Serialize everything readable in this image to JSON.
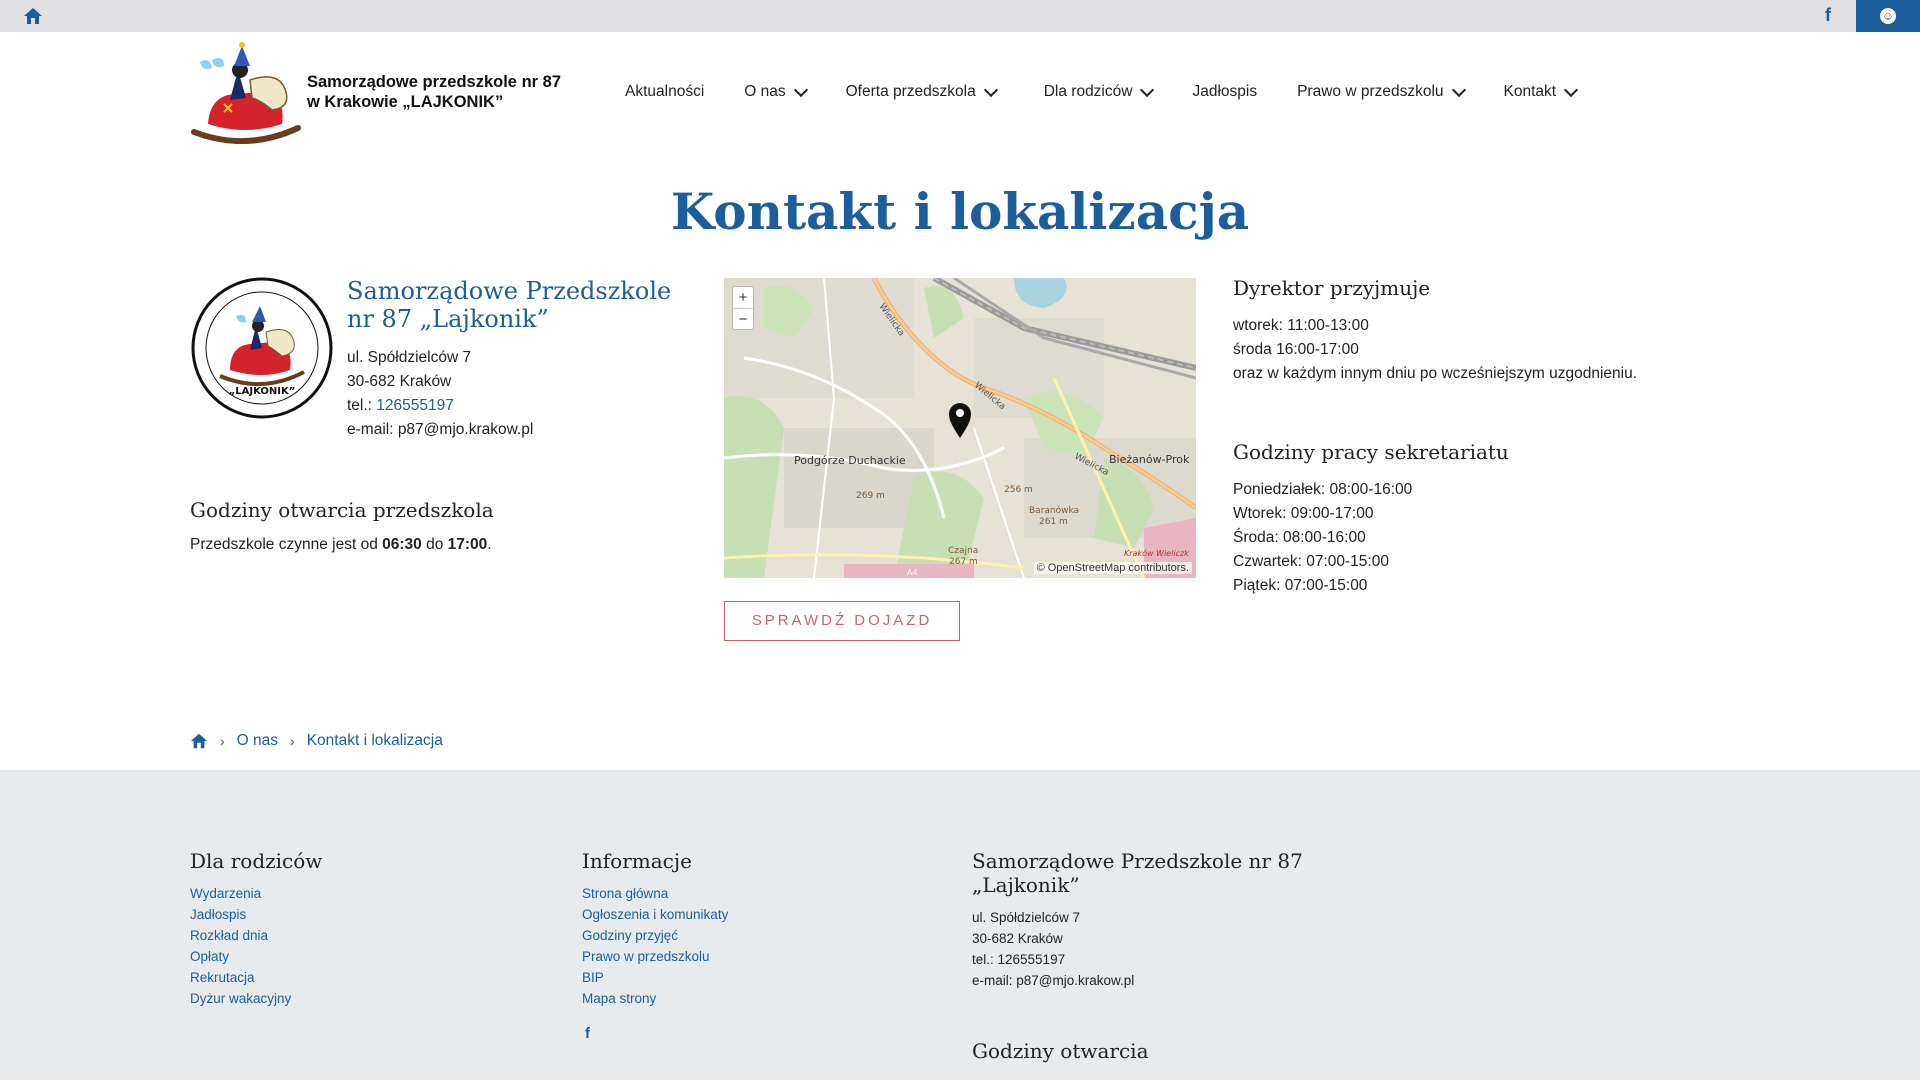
{
  "topbar": {
    "home_icon": "home-icon",
    "facebook_icon": "facebook-icon",
    "accessibility_icon": "accessibility-icon",
    "facebook_glyph": "f"
  },
  "header": {
    "school_name_line1": "Samorządowe przedszkole nr 87",
    "school_name_line2": "w Krakowie „LAJKONIK”"
  },
  "nav": {
    "items": [
      {
        "label": "Aktualności",
        "dropdown": false
      },
      {
        "label": "O nas",
        "dropdown": true
      },
      {
        "label": "Oferta przedszkola",
        "dropdown": true
      },
      {
        "label": "Dla rodziców",
        "dropdown": true
      },
      {
        "label": "Jadłospis",
        "dropdown": false
      },
      {
        "label": "Prawo w przedszkolu",
        "dropdown": true
      },
      {
        "label": "Kontakt",
        "dropdown": true
      }
    ]
  },
  "page": {
    "title": "Kontakt i lokalizacja"
  },
  "contact": {
    "name_line1": "Samorządowe Przedszkole",
    "name_line2": "nr 87 „Lajkonik”",
    "street": "ul. Spółdzielców 7",
    "city": "30-682 Kraków",
    "tel_label": "tel.: ",
    "tel": "126555197",
    "email": "e-mail: p87@mjo.krakow.pl"
  },
  "opening": {
    "heading": "Godziny otwarcia przedszkola",
    "text_prefix": "Przedszkole czynne jest od ",
    "from": "06:30",
    "middle": " do ",
    "to": "17:00",
    "suffix": "."
  },
  "map": {
    "zoom_in": "+",
    "zoom_out": "−",
    "attribution": "© OpenStreetMap contributors.",
    "labels": {
      "podgorze": "Podgórze Duchackie",
      "biezanow": "Bieżanów-Prok",
      "baranowka": "Baranówka",
      "height_261": "261 m",
      "height_256": "256 m",
      "height_269": "269 m",
      "czajna": "Czajna",
      "height_267": "267 m",
      "wielicka": "Wielicka",
      "a4": "A4",
      "krakow_wieliczka": "Kraków Wieliczk"
    },
    "marker_icon": "map-pin-icon"
  },
  "route_button": "SPRAWDŹ DOJAZD",
  "director": {
    "heading": "Dyrektor przyjmuje",
    "lines": [
      "wtorek: 11:00-13:00",
      "środa 16:00-17:00",
      "oraz w każdym innym dniu po wcześniejszym uzgodnieniu."
    ]
  },
  "secretariat": {
    "heading": "Godziny pracy sekretariatu",
    "lines": [
      "Poniedziałek: 08:00-16:00",
      "Wtorek: 09:00-17:00",
      "Środa: 08:00-16:00",
      "Czwartek: 07:00-15:00",
      "Piątek: 07:00-15:00"
    ]
  },
  "breadcrumb": {
    "home_icon": "home-icon",
    "items": [
      "O nas",
      "Kontakt i lokalizacja"
    ],
    "separator": "›"
  },
  "footer": {
    "col1": {
      "heading": "Dla rodziców",
      "links": [
        "Wydarzenia",
        "Jadłospis",
        "Rozkład dnia",
        "Opłaty",
        "Rekrutacja",
        "Dyżur wakacyjny"
      ]
    },
    "col2": {
      "heading": "Informacje",
      "links": [
        "Strona główna",
        "Ogłoszenia i komunikaty",
        "Godziny przyjęć",
        "Prawo w przedszkolu",
        "BIP",
        "Mapa strony"
      ]
    },
    "col3": {
      "heading_line1": "Samorządowe Przedszkole nr 87",
      "heading_line2": "„Lajkonik”",
      "lines": [
        "ul. Spółdzielców 7",
        "30-682 Kraków",
        "tel.: 126555197",
        "e-mail: p87@mjo.krakow.pl"
      ],
      "hours_heading": "Godziny otwarcia"
    },
    "facebook_glyph": "f"
  },
  "colors": {
    "brand": "#1c5d9c",
    "topbar": "#e0e0e2",
    "footer_bg": "#e8ebee",
    "button": "#c2646d"
  }
}
